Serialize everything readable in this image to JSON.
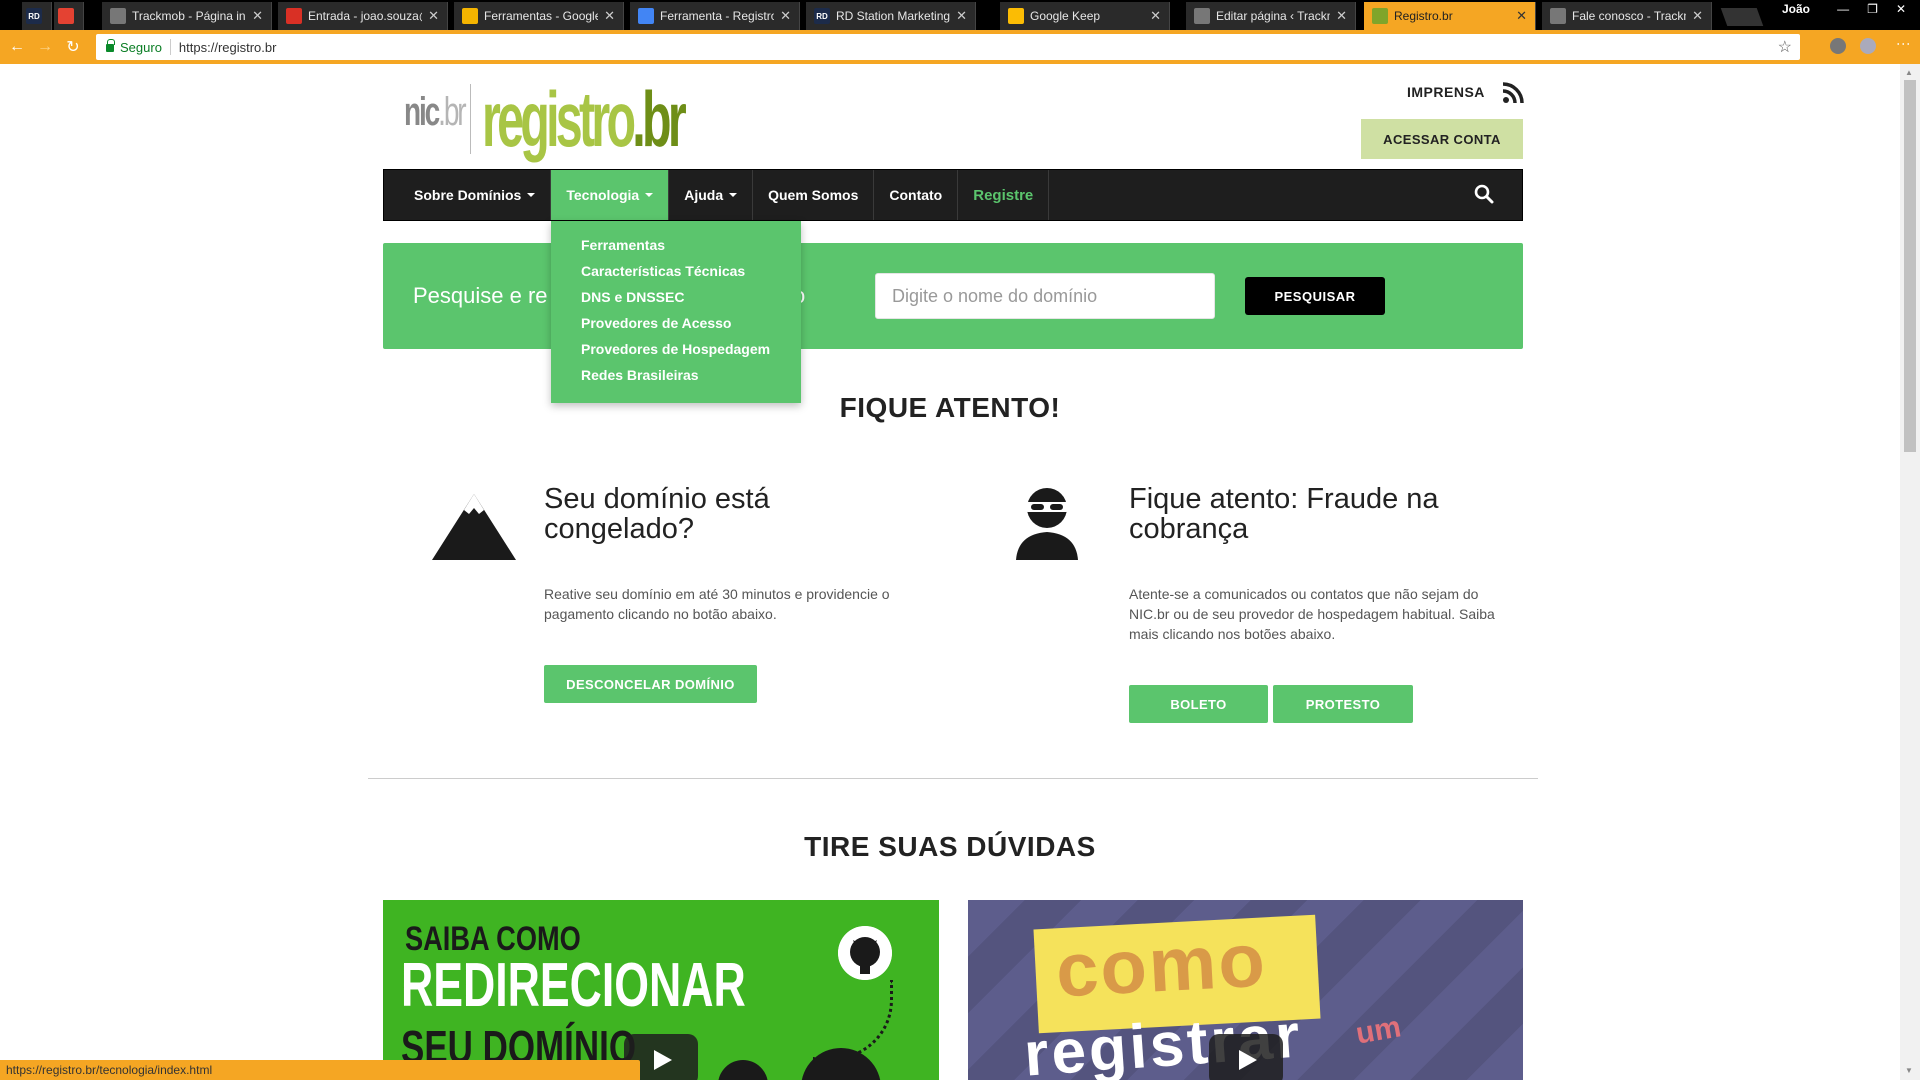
{
  "browser": {
    "tabs": [
      {
        "favicon": "RD",
        "title": ""
      },
      {
        "favicon": "todoist-icon",
        "title": ""
      },
      {
        "favicon": "page-icon",
        "title": "Trackmob - Página inic"
      },
      {
        "favicon": "gmail-icon",
        "title": "Entrada - joao.souza@"
      },
      {
        "favicon": "drive-icon",
        "title": "Ferramentas - Google"
      },
      {
        "favicon": "docs-icon",
        "title": "Ferramenta - Registro"
      },
      {
        "favicon": "RD",
        "title": "RD Station Marketing"
      },
      {
        "favicon": "keep-icon",
        "title": "Google Keep"
      },
      {
        "favicon": "page-icon",
        "title": "Editar página ‹ Trackm"
      },
      {
        "favicon": "registro-icon",
        "title": "Registro.br"
      },
      {
        "favicon": "page-icon",
        "title": "Fale conosco - Trackm"
      }
    ],
    "close_glyph": "✕",
    "profile_name": "João",
    "secure_label": "Seguro",
    "url": "https://registro.br",
    "status_url": "https://registro.br/tecnologia/index.html"
  },
  "header": {
    "logo_nic": "nic",
    "logo_nic_suffix": ".br",
    "logo_registro": "registro",
    "logo_registro_suffix": ".br",
    "imprensa_label": "IMPRENSA",
    "acessar_label": "ACESSAR CONTA"
  },
  "nav": {
    "items": [
      {
        "label": "Sobre Domínios"
      },
      {
        "label": "Tecnologia"
      },
      {
        "label": "Ajuda"
      },
      {
        "label": "Quem Somos"
      },
      {
        "label": "Contato"
      },
      {
        "label": "Registre"
      }
    ],
    "dropdown": [
      "Ferramentas",
      "Características Técnicas",
      "DNS e DNSSEC",
      "Provedores de Acesso",
      "Provedores de Hospedagem",
      "Redes Brasileiras"
    ]
  },
  "search": {
    "lead_text": "Pesquise e re",
    "lead_tail": "o",
    "placeholder": "Digite o nome do domínio",
    "button_label": "PESQUISAR"
  },
  "alerts": {
    "section_title": "FIQUE ATENTO!",
    "cards": [
      {
        "title": "Seu domínio está congelado?",
        "text": "Reative seu domínio em até 30 minutos e providencie o pagamento clicando no botão abaixo.",
        "buttons": [
          "DESCONCELAR DOMÍNIO"
        ]
      },
      {
        "title": "Fique atento: Fraude na cobrança",
        "text": "Atente-se a comunicados ou contatos que não sejam do NIC.br ou de seu provedor de hospedagem habitual. Saiba mais clicando nos botões abaixo.",
        "buttons": [
          "BOLETO",
          "PROTESTO"
        ]
      }
    ]
  },
  "faq": {
    "section_title": "TIRE SUAS DÚVIDAS",
    "video1": {
      "line1": "SAIBA COMO",
      "line2": "REDIRECIONAR",
      "line3": "SEU DOMÍNIO"
    },
    "video2": {
      "line1": "como",
      "line2": "registrar",
      "line3": "um"
    }
  },
  "colors": {
    "brand_green": "#5bc56d",
    "nav_dark": "#1e1e1e",
    "chrome_orange": "#f5a623",
    "logo_green": "#a8c545"
  }
}
